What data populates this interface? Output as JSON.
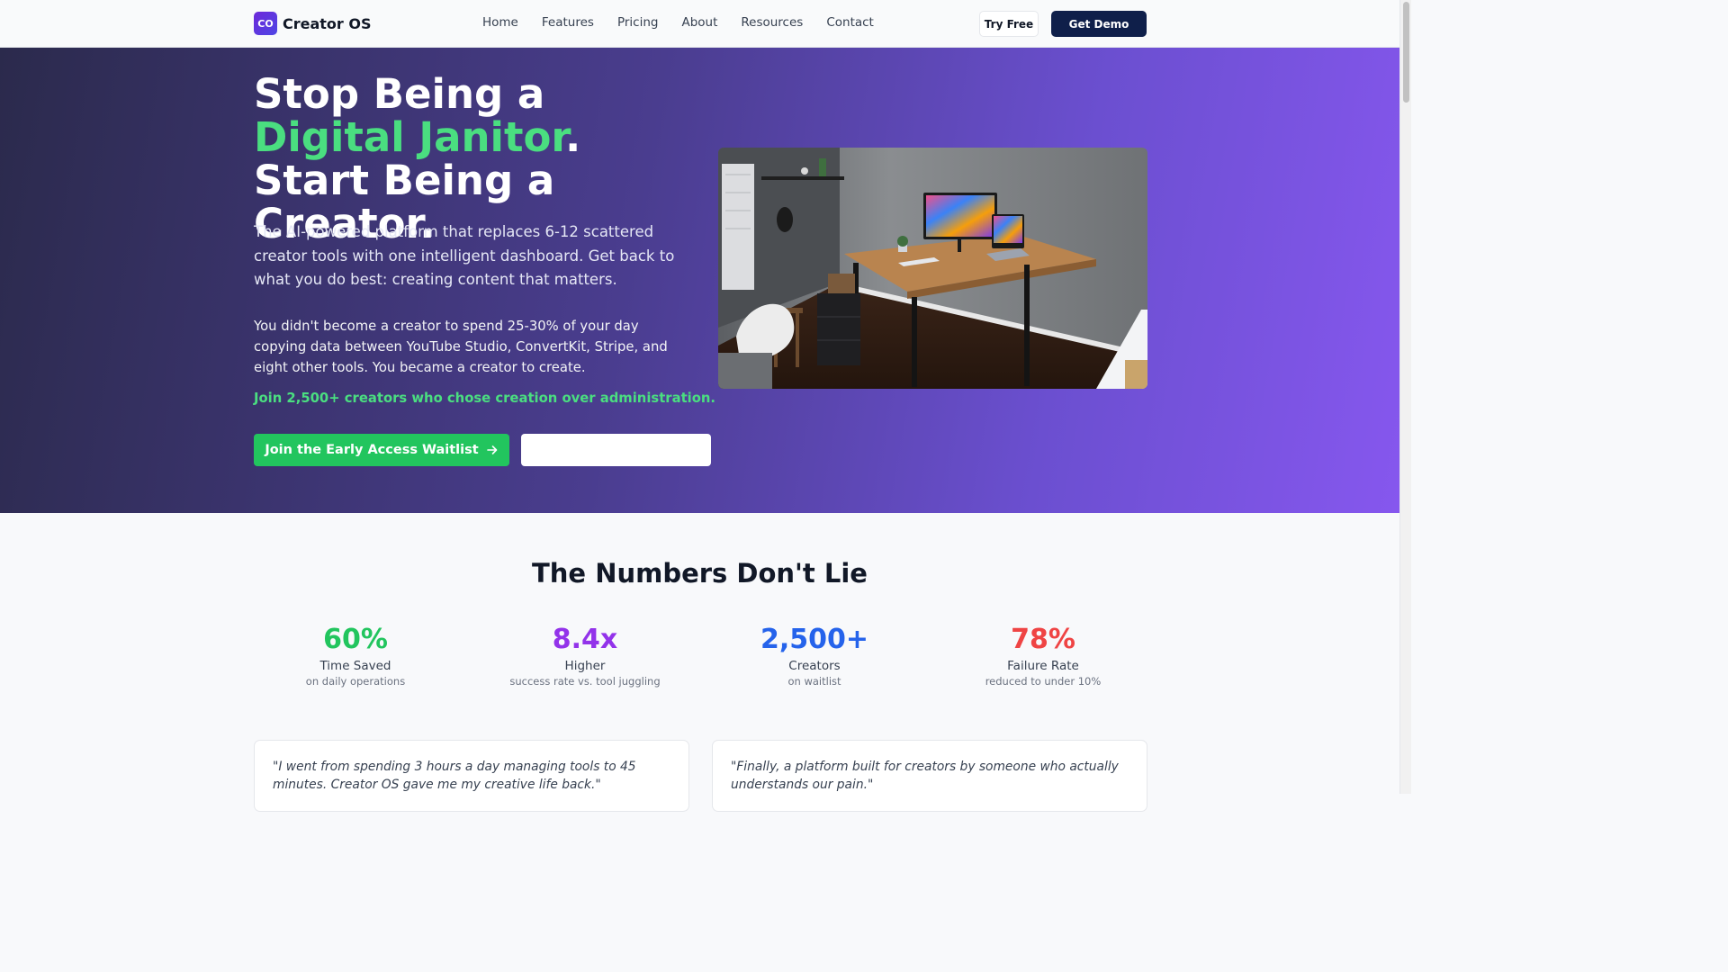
{
  "nav": {
    "logo_badge": "CO",
    "brand": "Creator OS",
    "links": [
      "Home",
      "Features",
      "Pricing",
      "About",
      "Resources",
      "Contact"
    ],
    "try_free": "Try Free",
    "get_demo": "Get Demo"
  },
  "hero": {
    "title_part1": "Stop Being a ",
    "title_accent": "Digital Janitor",
    "title_part2": ". Start Being a Creator.",
    "subtitle": "The AI-powered platform that replaces 6-12 scattered creator tools with one intelligent dashboard. Get back to what you do best: creating content that matters.",
    "body": "You didn't become a creator to spend 25-30% of your day copying data between YouTube Studio, ConvertKit, Stripe, and eight other tools. You became a creator to create.",
    "join_line": "Join 2,500+ creators who chose creation over administration.",
    "primary_cta": "Join the Early Access Waitlist",
    "primary_cta_icon": "arrow-right-icon",
    "image_subject": "home office desk photo"
  },
  "stats": {
    "title": "The Numbers Don't Lie",
    "items": [
      {
        "value": "60%",
        "label": "Time Saved",
        "note": "on daily operations",
        "color": "#22c55e"
      },
      {
        "value": "8.4x",
        "label": "Higher",
        "note": "success rate vs. tool juggling",
        "color": "#9333ea"
      },
      {
        "value": "2,500+",
        "label": "Creators",
        "note": "on waitlist",
        "color": "#2563eb"
      },
      {
        "value": "78%",
        "label": "Failure Rate",
        "note": "reduced to under 10%",
        "color": "#ef4444"
      }
    ]
  },
  "testimonials": [
    {
      "quote": "\"I went from spending 3 hours a day managing tools to 45 minutes. Creator OS gave me my creative life back.\""
    },
    {
      "quote": "\"Finally, a platform built for creators by someone who actually understands our pain.\""
    }
  ],
  "colors": {
    "accent_green": "#4ade80",
    "button_green": "#22c55e",
    "navy": "#0f1f4a"
  }
}
